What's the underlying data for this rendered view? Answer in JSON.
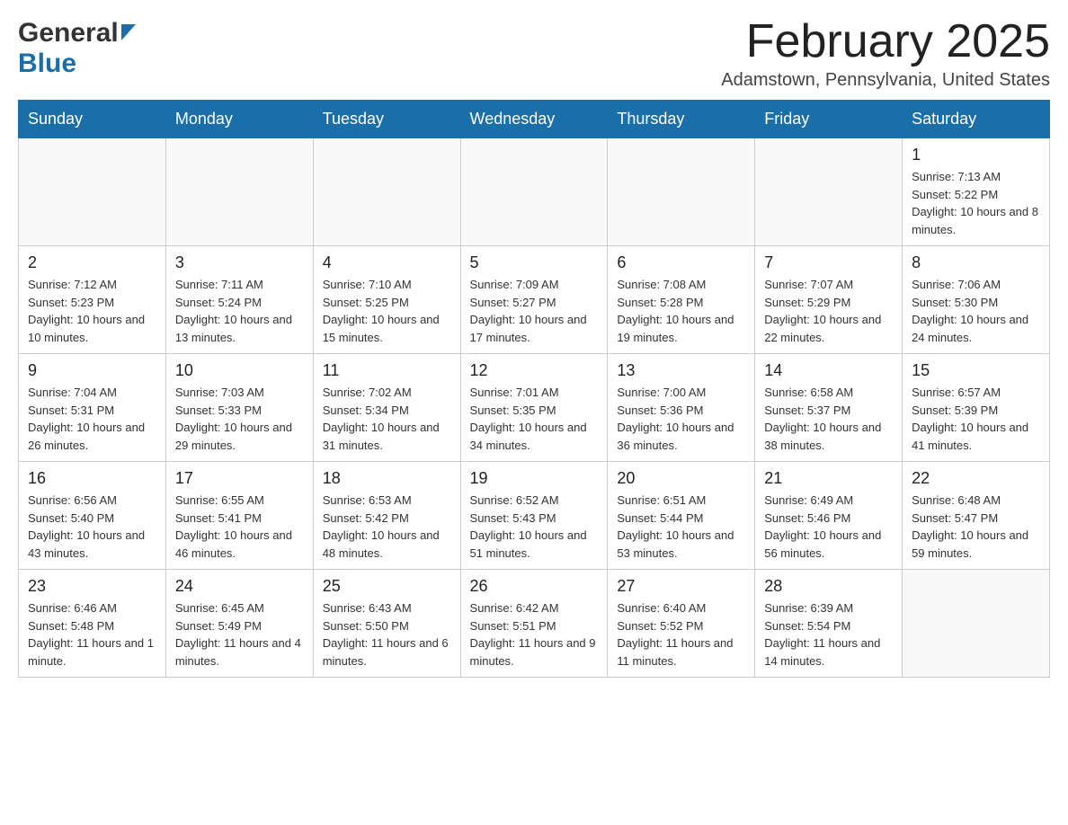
{
  "header": {
    "logo": {
      "general": "General",
      "blue": "Blue"
    },
    "title": "February 2025",
    "location": "Adamstown, Pennsylvania, United States"
  },
  "calendar": {
    "days_of_week": [
      "Sunday",
      "Monday",
      "Tuesday",
      "Wednesday",
      "Thursday",
      "Friday",
      "Saturday"
    ],
    "weeks": [
      {
        "days": [
          {
            "number": "",
            "info": "",
            "empty": true
          },
          {
            "number": "",
            "info": "",
            "empty": true
          },
          {
            "number": "",
            "info": "",
            "empty": true
          },
          {
            "number": "",
            "info": "",
            "empty": true
          },
          {
            "number": "",
            "info": "",
            "empty": true
          },
          {
            "number": "",
            "info": "",
            "empty": true
          },
          {
            "number": "1",
            "info": "Sunrise: 7:13 AM\nSunset: 5:22 PM\nDaylight: 10 hours and 8 minutes.",
            "empty": false
          }
        ]
      },
      {
        "days": [
          {
            "number": "2",
            "info": "Sunrise: 7:12 AM\nSunset: 5:23 PM\nDaylight: 10 hours and 10 minutes.",
            "empty": false
          },
          {
            "number": "3",
            "info": "Sunrise: 7:11 AM\nSunset: 5:24 PM\nDaylight: 10 hours and 13 minutes.",
            "empty": false
          },
          {
            "number": "4",
            "info": "Sunrise: 7:10 AM\nSunset: 5:25 PM\nDaylight: 10 hours and 15 minutes.",
            "empty": false
          },
          {
            "number": "5",
            "info": "Sunrise: 7:09 AM\nSunset: 5:27 PM\nDaylight: 10 hours and 17 minutes.",
            "empty": false
          },
          {
            "number": "6",
            "info": "Sunrise: 7:08 AM\nSunset: 5:28 PM\nDaylight: 10 hours and 19 minutes.",
            "empty": false
          },
          {
            "number": "7",
            "info": "Sunrise: 7:07 AM\nSunset: 5:29 PM\nDaylight: 10 hours and 22 minutes.",
            "empty": false
          },
          {
            "number": "8",
            "info": "Sunrise: 7:06 AM\nSunset: 5:30 PM\nDaylight: 10 hours and 24 minutes.",
            "empty": false
          }
        ]
      },
      {
        "days": [
          {
            "number": "9",
            "info": "Sunrise: 7:04 AM\nSunset: 5:31 PM\nDaylight: 10 hours and 26 minutes.",
            "empty": false
          },
          {
            "number": "10",
            "info": "Sunrise: 7:03 AM\nSunset: 5:33 PM\nDaylight: 10 hours and 29 minutes.",
            "empty": false
          },
          {
            "number": "11",
            "info": "Sunrise: 7:02 AM\nSunset: 5:34 PM\nDaylight: 10 hours and 31 minutes.",
            "empty": false
          },
          {
            "number": "12",
            "info": "Sunrise: 7:01 AM\nSunset: 5:35 PM\nDaylight: 10 hours and 34 minutes.",
            "empty": false
          },
          {
            "number": "13",
            "info": "Sunrise: 7:00 AM\nSunset: 5:36 PM\nDaylight: 10 hours and 36 minutes.",
            "empty": false
          },
          {
            "number": "14",
            "info": "Sunrise: 6:58 AM\nSunset: 5:37 PM\nDaylight: 10 hours and 38 minutes.",
            "empty": false
          },
          {
            "number": "15",
            "info": "Sunrise: 6:57 AM\nSunset: 5:39 PM\nDaylight: 10 hours and 41 minutes.",
            "empty": false
          }
        ]
      },
      {
        "days": [
          {
            "number": "16",
            "info": "Sunrise: 6:56 AM\nSunset: 5:40 PM\nDaylight: 10 hours and 43 minutes.",
            "empty": false
          },
          {
            "number": "17",
            "info": "Sunrise: 6:55 AM\nSunset: 5:41 PM\nDaylight: 10 hours and 46 minutes.",
            "empty": false
          },
          {
            "number": "18",
            "info": "Sunrise: 6:53 AM\nSunset: 5:42 PM\nDaylight: 10 hours and 48 minutes.",
            "empty": false
          },
          {
            "number": "19",
            "info": "Sunrise: 6:52 AM\nSunset: 5:43 PM\nDaylight: 10 hours and 51 minutes.",
            "empty": false
          },
          {
            "number": "20",
            "info": "Sunrise: 6:51 AM\nSunset: 5:44 PM\nDaylight: 10 hours and 53 minutes.",
            "empty": false
          },
          {
            "number": "21",
            "info": "Sunrise: 6:49 AM\nSunset: 5:46 PM\nDaylight: 10 hours and 56 minutes.",
            "empty": false
          },
          {
            "number": "22",
            "info": "Sunrise: 6:48 AM\nSunset: 5:47 PM\nDaylight: 10 hours and 59 minutes.",
            "empty": false
          }
        ]
      },
      {
        "days": [
          {
            "number": "23",
            "info": "Sunrise: 6:46 AM\nSunset: 5:48 PM\nDaylight: 11 hours and 1 minute.",
            "empty": false
          },
          {
            "number": "24",
            "info": "Sunrise: 6:45 AM\nSunset: 5:49 PM\nDaylight: 11 hours and 4 minutes.",
            "empty": false
          },
          {
            "number": "25",
            "info": "Sunrise: 6:43 AM\nSunset: 5:50 PM\nDaylight: 11 hours and 6 minutes.",
            "empty": false
          },
          {
            "number": "26",
            "info": "Sunrise: 6:42 AM\nSunset: 5:51 PM\nDaylight: 11 hours and 9 minutes.",
            "empty": false
          },
          {
            "number": "27",
            "info": "Sunrise: 6:40 AM\nSunset: 5:52 PM\nDaylight: 11 hours and 11 minutes.",
            "empty": false
          },
          {
            "number": "28",
            "info": "Sunrise: 6:39 AM\nSunset: 5:54 PM\nDaylight: 11 hours and 14 minutes.",
            "empty": false
          },
          {
            "number": "",
            "info": "",
            "empty": true
          }
        ]
      }
    ]
  }
}
